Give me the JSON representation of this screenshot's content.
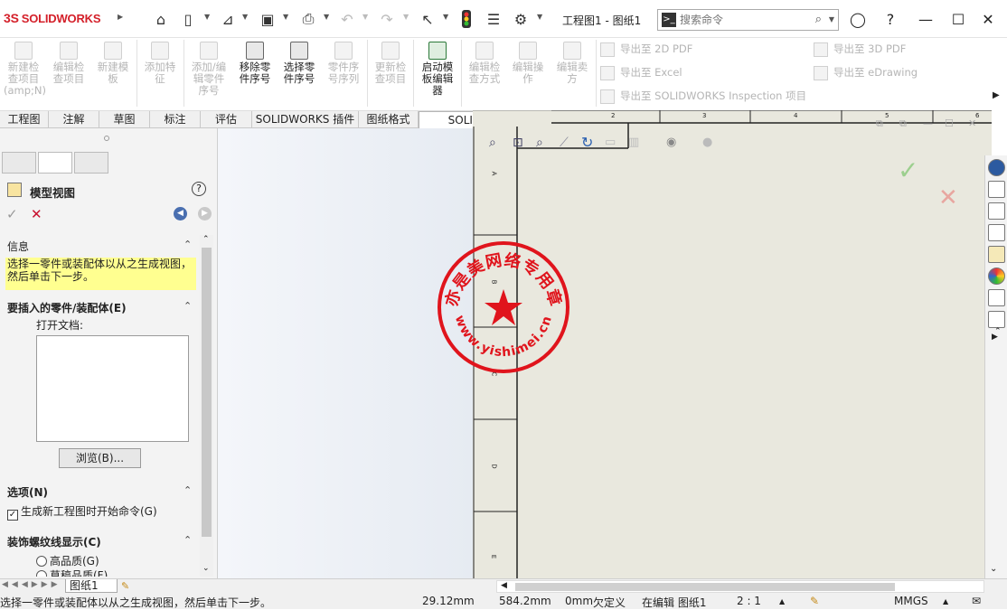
{
  "app": {
    "logo": "SOLIDWORKS",
    "logo_mark": "3S",
    "document_title": "工程图1 - 图纸1"
  },
  "search": {
    "placeholder": "搜索命令",
    "prompt_glyph": ">_"
  },
  "ribbon": {
    "groups": [
      {
        "label": "新建检\n查项目\n(amp;N)",
        "enabled": false
      },
      {
        "label": "编辑检\n查项目",
        "enabled": false
      },
      {
        "label": "新建模\n板",
        "enabled": false
      },
      {
        "label": "添加特\n征",
        "enabled": false
      },
      {
        "label": "添加/编\n辑零件\n序号",
        "enabled": false
      },
      {
        "label": "移除零\n件序号",
        "enabled": true
      },
      {
        "label": "选择零\n件序号",
        "enabled": true
      },
      {
        "label": "零件序\n号序列",
        "enabled": false
      },
      {
        "label": "更新检\n查项目",
        "enabled": false
      },
      {
        "label": "启动模\n板编辑\n器",
        "enabled": true
      },
      {
        "label": "编辑检\n查方式",
        "enabled": false
      },
      {
        "label": "编辑操\n作",
        "enabled": false
      },
      {
        "label": "编辑卖\n方",
        "enabled": false
      }
    ],
    "export": {
      "pdf2d": "导出至 2D PDF",
      "excel": "导出至 Excel",
      "inspection": "导出至 SOLIDWORKS Inspection 项目",
      "pdf3d": "导出至 3D PDF",
      "edrawing": "导出至 eDrawing"
    }
  },
  "tabs": [
    "工程图",
    "注解",
    "草图",
    "标注",
    "评估",
    "SOLIDWORKS 插件",
    "图纸格式",
    "SOLIDWORKS Inspection"
  ],
  "active_tab": "SOLIDWORKS Inspection",
  "panel": {
    "title": "模型视图",
    "info_header": "信息",
    "info_text": "选择一零件或装配体以从之生成视图，然后单击下一步。",
    "insert_header": "要插入的零件/装配体(E)",
    "open_docs_label": "打开文档:",
    "browse_button": "浏览(B)...",
    "options_header": "选项(N)",
    "options_checkbox": "生成新工程图时开始命令(G)",
    "options_checked": true,
    "thread_header": "装饰螺纹线显示(C)",
    "radio_high": "高品质(G)",
    "radio_draft": "草稿品质(F)"
  },
  "sheet": {
    "top_labels": [
      "2",
      "3",
      "4",
      "5",
      "6"
    ],
    "side_labels": [
      "A",
      "B",
      "C",
      "D",
      "E"
    ]
  },
  "stamp": {
    "text": "亦是美网络专用章",
    "url": "www.yishimei.cn"
  },
  "sheet_tab": "图纸1",
  "status": {
    "message": "选择一零件或装配体以从之生成视图，然后单击下一步。",
    "x": "29.12mm",
    "y": "584.2mm",
    "z": "0mm",
    "state": "欠定义",
    "editing": "在编辑 图纸1",
    "scale": "2 : 1",
    "units": "MMGS"
  },
  "colors": {
    "stamp": "#e0141c",
    "ok_green": "#9ccf8e",
    "cancel_red": "#e8a6a0",
    "sheet_bg": "#e9e8de"
  }
}
